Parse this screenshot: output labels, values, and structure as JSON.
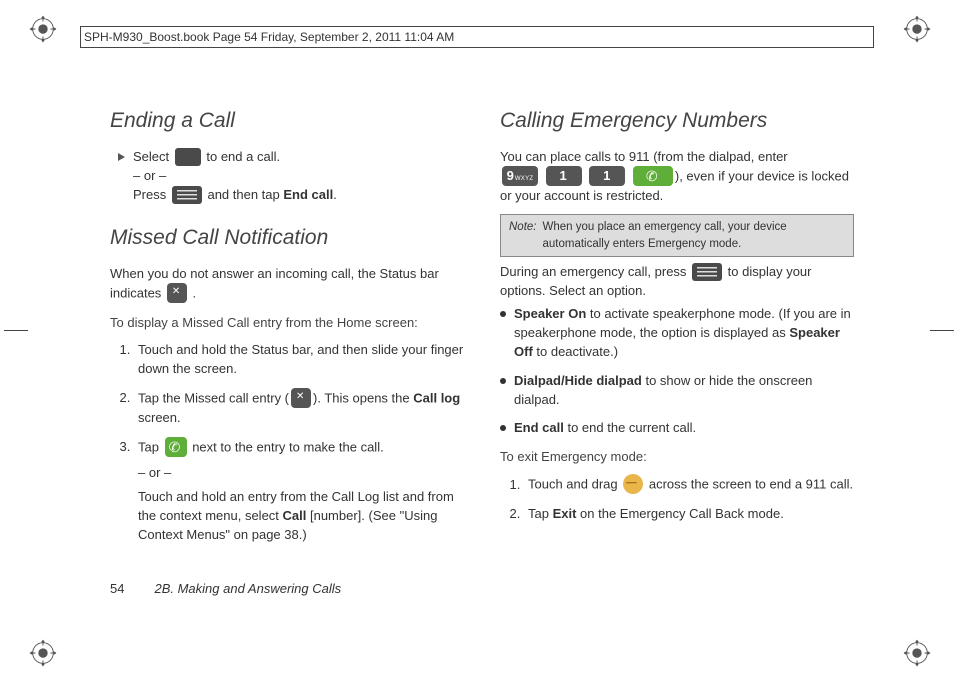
{
  "header": {
    "text": "SPH-M930_Boost.book  Page 54  Friday, September 2, 2011  11:04 AM"
  },
  "left": {
    "h_ending": "Ending a Call",
    "select_text_a": "Select ",
    "select_text_b": " to end a call.",
    "or": "– or –",
    "press_a": "Press ",
    "press_b": " and then tap ",
    "end_call": "End call",
    "period": ".",
    "h_missed": "Missed Call Notification",
    "missed_p": "When you do not answer an incoming call, the Status bar indicates ",
    "missed_p_end": ".",
    "missed_sub": "To display a Missed Call entry from the Home screen:",
    "s1": "Touch and hold the Status bar, and then slide your finger down the screen.",
    "s2a": "Tap the Missed call entry (",
    "s2b": "). This opens the ",
    "s2_bold": "Call log",
    "s2c": " screen.",
    "s3a": "Tap ",
    "s3b": " next to the entry to make the call.",
    "s3_or": "– or –",
    "s3_p2a": "Touch and hold an entry from the Call Log list and from the context menu, select ",
    "s3_bold": "Call",
    "s3_p2b": " [number]. (See \"Using Context Menus\" on page 38.)"
  },
  "right": {
    "h_emerg": "Calling Emergency Numbers",
    "p1a": "You can place calls to 911 (from the dialpad, enter ",
    "key9_big": "9",
    "key9_sm": "WXYZ",
    "key1a_big": "1",
    "key1b_big": "1",
    "p1b": "), even if your device is locked or your account is restricted.",
    "note_label": "Note:",
    "note_text": "When you place an emergency call, your device automatically enters Emergency mode.",
    "p2a": "During an emergency call, press ",
    "p2b": " to display your options. Select an option.",
    "b1_bold": "Speaker On",
    "b1_txt": " to activate speakerphone mode. (If you are in speakerphone mode, the option is displayed as ",
    "b1_bold2": "Speaker Off",
    "b1_txt2": " to deactivate.)",
    "b2_bold": "Dialpad/Hide dialpad",
    "b2_txt": " to show or hide the onscreen dialpad.",
    "b3_bold": "End call",
    "b3_txt": " to end the current call.",
    "exit_sub": "To exit Emergency mode:",
    "e1a": "Touch and drag ",
    "e1b": " across the screen to end a 911 call.",
    "e2a": "Tap ",
    "e2_bold": "Exit",
    "e2b": " on the Emergency Call Back mode."
  },
  "footer": {
    "page": "54",
    "chapter": "2B. Making and Answering Calls"
  }
}
